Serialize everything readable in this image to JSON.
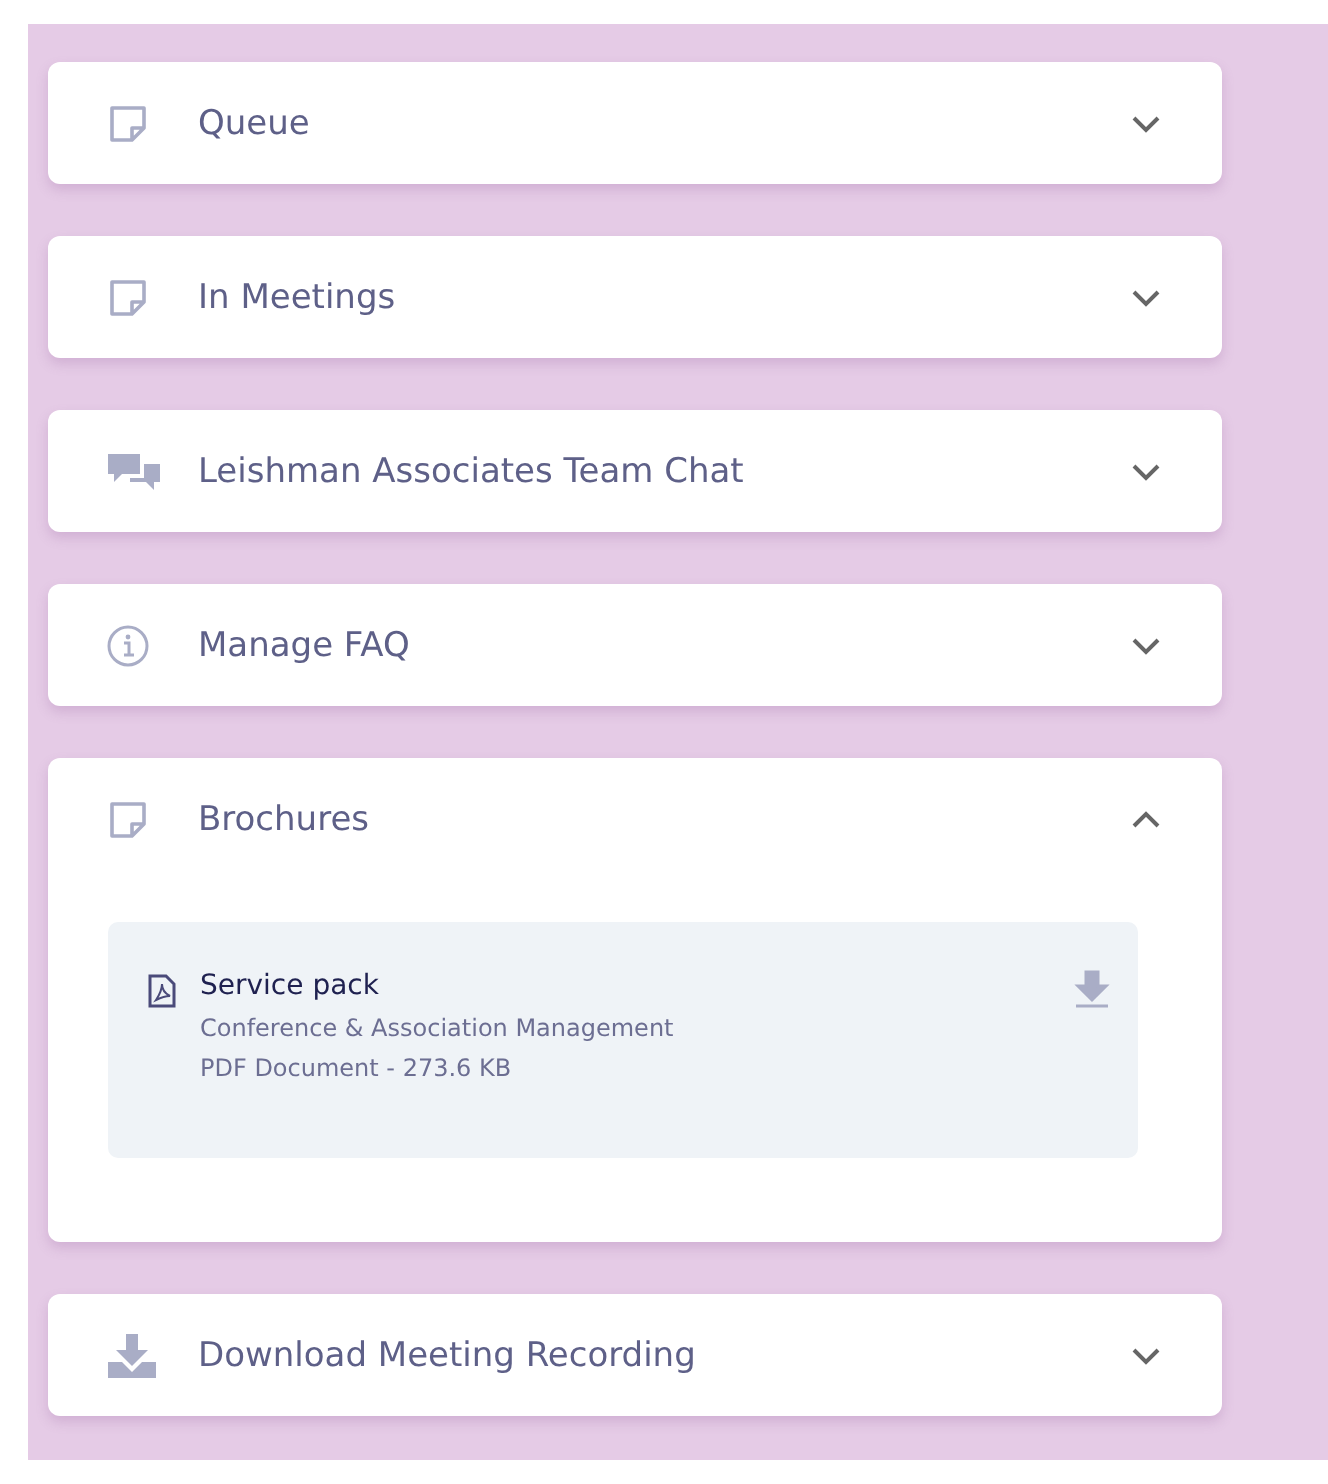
{
  "sections": [
    {
      "title": "Queue",
      "kind": "note",
      "expanded": false
    },
    {
      "title": "In Meetings",
      "kind": "note",
      "expanded": false
    },
    {
      "title": "Leishman Associates Team Chat",
      "kind": "chat",
      "expanded": false
    },
    {
      "title": "Manage FAQ",
      "kind": "info",
      "expanded": false
    },
    {
      "title": "Brochures",
      "kind": "note",
      "expanded": true,
      "files": [
        {
          "name": "Service pack",
          "description": "Conference & Association Management",
          "meta": "PDF Document - 273.6 KB"
        }
      ]
    },
    {
      "title": "Download Meeting Recording",
      "kind": "download",
      "expanded": false
    }
  ]
}
